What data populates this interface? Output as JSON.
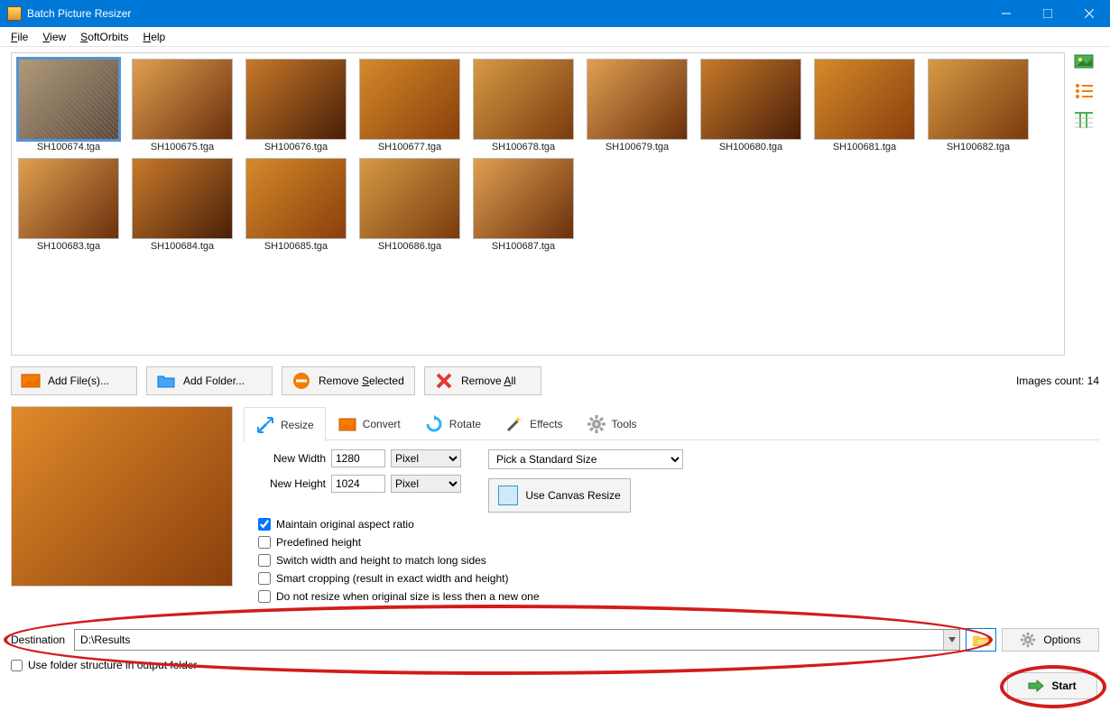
{
  "window": {
    "title": "Batch Picture Resizer"
  },
  "menu": {
    "file": "File",
    "view": "View",
    "softorbits": "SoftOrbits",
    "help": "Help"
  },
  "thumbnails": [
    {
      "name": "SH100674.tga",
      "selected": true
    },
    {
      "name": "SH100675.tga"
    },
    {
      "name": "SH100676.tga"
    },
    {
      "name": "SH100677.tga"
    },
    {
      "name": "SH100678.tga"
    },
    {
      "name": "SH100679.tga"
    },
    {
      "name": "SH100680.tga"
    },
    {
      "name": "SH100681.tga"
    },
    {
      "name": "SH100682.tga"
    },
    {
      "name": "SH100683.tga"
    },
    {
      "name": "SH100684.tga"
    },
    {
      "name": "SH100685.tga"
    },
    {
      "name": "SH100686.tga"
    },
    {
      "name": "SH100687.tga"
    }
  ],
  "toolbar": {
    "add_files": "Add File(s)...",
    "add_folder": "Add Folder...",
    "remove_selected": "Remove Selected",
    "remove_all": "Remove All",
    "count_label": "Images count: 14"
  },
  "tabs": {
    "resize": "Resize",
    "convert": "Convert",
    "rotate": "Rotate",
    "effects": "Effects",
    "tools": "Tools"
  },
  "resize": {
    "new_width_label": "New Width",
    "new_width_value": "1280",
    "new_height_label": "New Height",
    "new_height_value": "1024",
    "unit": "Pixel",
    "std_placeholder": "Pick a Standard Size",
    "canvas_btn": "Use Canvas Resize",
    "maintain_aspect": "Maintain original aspect ratio",
    "predefined_height": "Predefined height",
    "switch_wh": "Switch width and height to match long sides",
    "smart_crop": "Smart cropping (result in exact width and height)",
    "no_resize_smaller": "Do not resize when original size is less then a new one"
  },
  "destination": {
    "label": "Destination",
    "value": "D:\\Results",
    "options": "Options",
    "folder_structure": "Use folder structure in output folder"
  },
  "start": {
    "label": "Start"
  }
}
